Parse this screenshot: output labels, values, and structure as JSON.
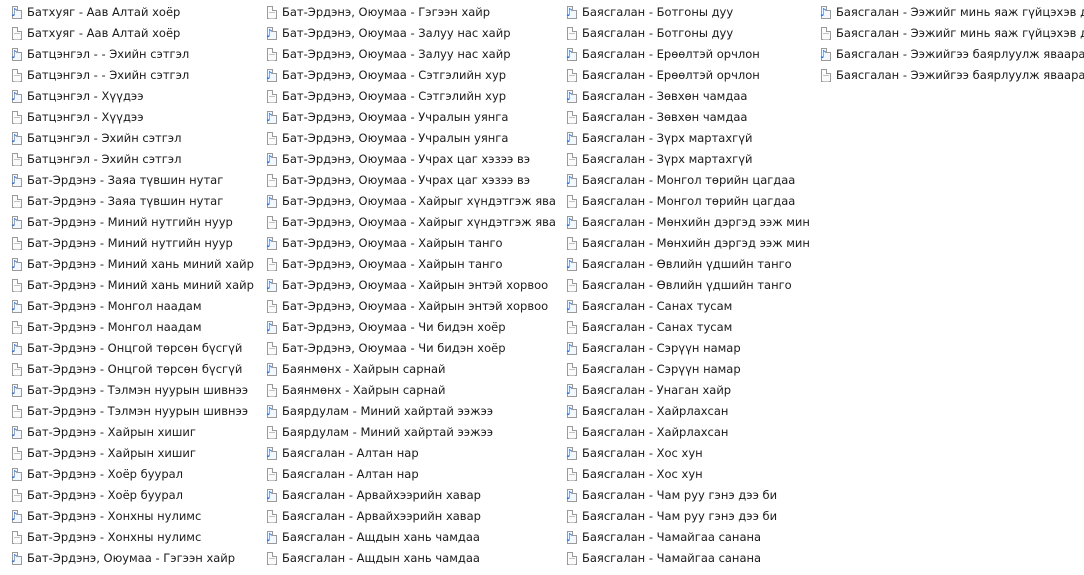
{
  "icons": {
    "audio": "music-note-file-icon",
    "doc": "blank-file-icon"
  },
  "colors": {
    "music_note": "#2a6fd6",
    "icon_border": "#9a9a9a",
    "background": "#ffffff",
    "text": "#1a1a1a"
  },
  "columns": [
    {
      "items": [
        {
          "label": "Батхуяг - Аав Алтай хоёр",
          "type": "audio"
        },
        {
          "label": "Батхуяг - Аав Алтай хоёр",
          "type": "doc"
        },
        {
          "label": "Батцэнгэл - - Эхийн сэтгэл",
          "type": "audio"
        },
        {
          "label": "Батцэнгэл - - Эхийн сэтгэл",
          "type": "doc"
        },
        {
          "label": "Батцэнгэл - Хүүдээ",
          "type": "audio"
        },
        {
          "label": "Батцэнгэл - Хүүдээ",
          "type": "doc"
        },
        {
          "label": "Батцэнгэл - Эхийн сэтгэл",
          "type": "audio"
        },
        {
          "label": "Батцэнгэл - Эхийн сэтгэл",
          "type": "doc"
        },
        {
          "label": "Бат-Эрдэнэ - Заяа түвшин нутаг",
          "type": "audio"
        },
        {
          "label": "Бат-Эрдэнэ - Заяа түвшин нутаг",
          "type": "doc"
        },
        {
          "label": "Бат-Эрдэнэ - Миний нутгийн нуур",
          "type": "audio"
        },
        {
          "label": "Бат-Эрдэнэ - Миний нутгийн нуур",
          "type": "doc"
        },
        {
          "label": "Бат-Эрдэнэ - Миний хань миний хайр",
          "type": "audio"
        },
        {
          "label": "Бат-Эрдэнэ - Миний хань миний хайр",
          "type": "doc"
        },
        {
          "label": "Бат-Эрдэнэ - Монгол наадам",
          "type": "audio"
        },
        {
          "label": "Бат-Эрдэнэ - Монгол наадам",
          "type": "doc"
        },
        {
          "label": "Бат-Эрдэнэ - Онцгой төрсөн бүсгүй",
          "type": "audio"
        },
        {
          "label": "Бат-Эрдэнэ - Онцгой төрсөн бүсгүй",
          "type": "doc"
        },
        {
          "label": "Бат-Эрдэнэ - Тэлмэн нуурын шивнээ",
          "type": "audio"
        },
        {
          "label": "Бат-Эрдэнэ - Тэлмэн нуурын шивнээ",
          "type": "doc"
        },
        {
          "label": "Бат-Эрдэнэ - Хайрын хишиг",
          "type": "audio"
        },
        {
          "label": "Бат-Эрдэнэ - Хайрын хишиг",
          "type": "doc"
        },
        {
          "label": "Бат-Эрдэнэ - Хоёр буурал",
          "type": "audio"
        },
        {
          "label": "Бат-Эрдэнэ - Хоёр буурал",
          "type": "doc"
        },
        {
          "label": "Бат-Эрдэнэ - Хонхны нулимс",
          "type": "audio"
        },
        {
          "label": "Бат-Эрдэнэ - Хонхны нулимс",
          "type": "doc"
        },
        {
          "label": "Бат-Эрдэнэ, Оюумаа - Гэгээн хайр",
          "type": "audio"
        }
      ]
    },
    {
      "items": [
        {
          "label": "Бат-Эрдэнэ, Оюумаа - Гэгээн хайр",
          "type": "doc"
        },
        {
          "label": "Бат-Эрдэнэ, Оюумаа - Залуу нас хайр",
          "type": "audio"
        },
        {
          "label": "Бат-Эрдэнэ, Оюумаа - Залуу нас хайр",
          "type": "doc"
        },
        {
          "label": "Бат-Эрдэнэ, Оюумаа - Сэтгэлийн хур",
          "type": "audio"
        },
        {
          "label": "Бат-Эрдэнэ, Оюумаа - Сэтгэлийн хур",
          "type": "doc"
        },
        {
          "label": "Бат-Эрдэнэ, Оюумаа - Учралын уянга",
          "type": "audio"
        },
        {
          "label": "Бат-Эрдэнэ, Оюумаа - Учралын уянга",
          "type": "doc"
        },
        {
          "label": "Бат-Эрдэнэ, Оюумаа - Учрах цаг хэзээ вэ",
          "type": "audio"
        },
        {
          "label": "Бат-Эрдэнэ, Оюумаа - Учрах цаг хэзээ вэ",
          "type": "doc"
        },
        {
          "label": "Бат-Эрдэнэ, Оюумаа - Хайрыг хүндэтгэж яваарай",
          "type": "audio"
        },
        {
          "label": "Бат-Эрдэнэ, Оюумаа - Хайрыг хүндэтгэж яваарай",
          "type": "doc"
        },
        {
          "label": "Бат-Эрдэнэ, Оюумаа - Хайрын танго",
          "type": "audio"
        },
        {
          "label": "Бат-Эрдэнэ, Оюумаа - Хайрын танго",
          "type": "doc"
        },
        {
          "label": "Бат-Эрдэнэ, Оюумаа - Хайрын энтэй хорвоо",
          "type": "audio"
        },
        {
          "label": "Бат-Эрдэнэ, Оюумаа - Хайрын энтэй хорвоо",
          "type": "doc"
        },
        {
          "label": "Бат-Эрдэнэ, Оюумаа - Чи бидэн хоёр",
          "type": "audio"
        },
        {
          "label": "Бат-Эрдэнэ, Оюумаа - Чи бидэн хоёр",
          "type": "doc"
        },
        {
          "label": "Баянмөнх - Хайрын сарнай",
          "type": "audio"
        },
        {
          "label": "Баянмөнх - Хайрын сарнай",
          "type": "doc"
        },
        {
          "label": "Баярдулам - Миний хайртай ээжээ",
          "type": "audio"
        },
        {
          "label": "Баярдулам - Миний хайртай ээжээ",
          "type": "doc"
        },
        {
          "label": "Баясгалан - Алтан нар",
          "type": "audio"
        },
        {
          "label": "Баясгалан - Алтан нар",
          "type": "doc"
        },
        {
          "label": "Баясгалан - Арвайхээрийн хавар",
          "type": "audio"
        },
        {
          "label": "Баясгалан - Арвайхээрийн хавар",
          "type": "doc"
        },
        {
          "label": "Баясгалан - Ащдын хань чамдаа",
          "type": "audio"
        },
        {
          "label": "Баясгалан - Ащдын хань чамдаа",
          "type": "doc"
        }
      ]
    },
    {
      "items": [
        {
          "label": "Баясгалан - Ботгоны дуу",
          "type": "audio"
        },
        {
          "label": "Баясгалан - Ботгоны дуу",
          "type": "doc"
        },
        {
          "label": "Баясгалан - Ерөөлтэй орчлон",
          "type": "audio"
        },
        {
          "label": "Баясгалан - Ерөөлтэй орчлон",
          "type": "doc"
        },
        {
          "label": "Баясгалан - Зөвхөн чамдаа",
          "type": "audio"
        },
        {
          "label": "Баясгалан - Зөвхөн чамдаа",
          "type": "doc"
        },
        {
          "label": "Баясгалан - Зүрх мартахгүй",
          "type": "audio"
        },
        {
          "label": "Баясгалан - Зүрх мартахгүй",
          "type": "doc"
        },
        {
          "label": "Баясгалан - Монгол төрийн цагдаа",
          "type": "audio"
        },
        {
          "label": "Баясгалан - Монгол төрийн цагдаа",
          "type": "doc"
        },
        {
          "label": "Баясгалан - Мөнхийн дэргэд ээж минь",
          "type": "audio"
        },
        {
          "label": "Баясгалан - Мөнхийн дэргэд ээж минь",
          "type": "doc"
        },
        {
          "label": "Баясгалан - Өвлийн үдшийн танго",
          "type": "audio"
        },
        {
          "label": "Баясгалан - Өвлийн үдшийн танго",
          "type": "doc"
        },
        {
          "label": "Баясгалан - Санах тусам",
          "type": "audio"
        },
        {
          "label": "Баясгалан - Санах тусам",
          "type": "doc"
        },
        {
          "label": "Баясгалан - Сэрүүн намар",
          "type": "audio"
        },
        {
          "label": "Баясгалан - Сэрүүн намар",
          "type": "doc"
        },
        {
          "label": "Баясгалан - Унаган хайр",
          "type": "audio"
        },
        {
          "label": "Баясгалан - Хайрлахсан",
          "type": "audio"
        },
        {
          "label": "Баясгалан - Хайрлахсан",
          "type": "doc"
        },
        {
          "label": "Баясгалан - Хос хун",
          "type": "audio"
        },
        {
          "label": "Баясгалан - Хос хун",
          "type": "doc"
        },
        {
          "label": "Баясгалан - Чам руу гэнэ дээ би",
          "type": "audio"
        },
        {
          "label": "Баясгалан - Чам руу гэнэ дээ би",
          "type": "doc"
        },
        {
          "label": "Баясгалан - Чамайгаа санана",
          "type": "audio"
        },
        {
          "label": "Баясгалан - Чамайгаа санана",
          "type": "doc"
        }
      ]
    },
    {
      "items": [
        {
          "label": "Баясгалан - Ээжийг минь яаж гүйцэхэв дээ",
          "type": "audio"
        },
        {
          "label": "Баясгалан - Ээжийг минь яаж гүйцэхэв дээ",
          "type": "doc"
        },
        {
          "label": "Баясгалан - Ээжийгээ баярлуулж яваарай",
          "type": "audio"
        },
        {
          "label": "Баясгалан - Ээжийгээ баярлуулж яваарай",
          "type": "doc"
        }
      ]
    }
  ]
}
